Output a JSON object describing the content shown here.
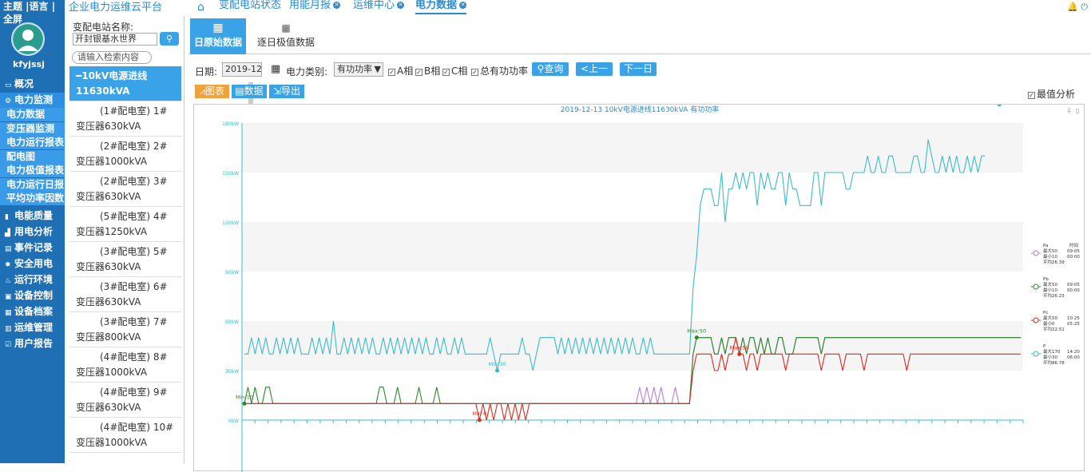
{
  "nav": {
    "top_menu": "主题 |语言 | 全屏",
    "username": "kfyjssj",
    "items": [
      {
        "label": "概况",
        "icon": "monitor-icon",
        "active": false
      },
      {
        "label": "电力监测",
        "icon": "gear-icon",
        "active": true
      },
      {
        "label": "电能质量",
        "icon": "bar-icon",
        "active": false
      },
      {
        "label": "用电分析",
        "icon": "chart-icon",
        "active": false
      },
      {
        "label": "事件记录",
        "icon": "list-icon",
        "active": false
      },
      {
        "label": "安全用电",
        "icon": "shield-icon",
        "active": false
      },
      {
        "label": "运行环境",
        "icon": "env-icon",
        "active": false
      },
      {
        "label": "设备控制",
        "icon": "control-icon",
        "active": false
      },
      {
        "label": "设备档案",
        "icon": "file-icon",
        "active": false
      },
      {
        "label": "运维管理",
        "icon": "tool-icon",
        "active": false
      },
      {
        "label": "用户报告",
        "icon": "report-icon",
        "active": false
      }
    ],
    "sub_items": [
      "电力数据",
      "变压器监测",
      "电力运行报表",
      "配电图",
      "电力极值报表",
      "电力运行日报",
      "平均功率因数"
    ]
  },
  "platform_title": "企业电力运维云平台",
  "tabs": [
    {
      "label": "变配电站状态",
      "closable": false,
      "active": false
    },
    {
      "label": "用能月报",
      "closable": true,
      "active": false
    },
    {
      "label": "运维中心",
      "closable": true,
      "active": false
    },
    {
      "label": "电力数据",
      "closable": true,
      "active": true
    }
  ],
  "station_panel": {
    "label": "变配电站名称:",
    "station_value": "开封银基水世界",
    "filter_placeholder": "请输入检索内容",
    "items": [
      "━10kV电源进线11630kVA",
      "(1#配电室) 1#变压器630kVA",
      "(2#配电室) 2#变压器1000kVA",
      "(2#配电室) 3#变压器630kVA",
      "(5#配电室) 4#变压器1250kVA",
      "(3#配电室) 5#变压器630kVA",
      "(3#配电室) 6#变压器630kVA",
      "(3#配电室) 7#变压器800kVA",
      "(4#配电室) 8#变压器1000kVA",
      "(4#配电室) 9#变压器630kVA",
      "(4#配电室) 10#变压器1000kVA"
    ]
  },
  "subtabs": [
    "日原始数据",
    "逐日极值数据"
  ],
  "toolbar": {
    "date_label": "日期:",
    "date_value": "2019-12-13",
    "type_label": "电力类别:",
    "type_value": "有功功率",
    "checks": [
      "A相",
      "B相",
      "C相",
      "总有功功率"
    ],
    "query": "查询",
    "prev": "上一日",
    "next": "下一日",
    "chart_btn": "图表",
    "data_btn": "数据",
    "export_btn": "导出",
    "best_label": "最值分析"
  },
  "chart_data": {
    "type": "line",
    "title": "2019-12-13  10kV电源进线11630kVA  有功功率",
    "y_ticks": [
      "0kW",
      "30kW",
      "60kW",
      "90kW",
      "120kW",
      "150kW",
      "180kW"
    ],
    "ylim": [
      0,
      180
    ],
    "colors": {
      "Pa": "#b57fe0",
      "Pb": "#2a8a2a",
      "Pc": "#e0281c",
      "P": "#3bbcc8"
    },
    "series": [
      {
        "name": "Pa",
        "stats": [
          "最大50",
          "09:05",
          "最小10",
          "00:00",
          "平均26.39"
        ],
        "values": [
          10,
          10,
          10,
          10,
          10,
          10,
          10,
          10,
          10,
          10,
          10,
          10,
          10,
          10,
          10,
          10,
          10,
          10,
          10,
          10,
          10,
          10,
          10,
          10,
          10,
          10,
          10,
          10,
          10,
          10,
          10,
          10,
          10,
          10,
          10,
          10,
          10,
          10,
          10,
          10,
          10,
          10,
          10,
          10,
          10,
          10,
          10,
          10,
          10,
          10,
          10,
          10,
          10,
          10,
          10,
          10,
          10,
          10,
          10,
          10,
          10,
          10,
          10,
          10,
          10,
          10,
          10,
          10,
          10,
          10,
          10,
          10,
          10,
          10,
          10,
          10,
          10,
          10,
          10,
          10,
          10,
          10,
          10,
          10,
          10,
          10,
          10,
          10,
          10,
          10,
          10,
          10,
          10,
          10,
          10,
          10,
          10,
          10,
          10,
          10,
          10,
          10,
          10,
          10,
          10,
          10,
          10,
          10,
          10,
          10,
          10,
          20,
          10,
          20,
          10,
          20,
          10,
          20,
          10,
          10,
          10,
          20,
          10,
          10,
          10,
          10,
          40,
          50,
          50,
          50,
          50,
          50,
          40,
          40,
          50,
          40,
          50,
          50,
          50,
          40,
          50,
          40,
          50,
          50,
          40,
          50,
          40,
          50,
          40,
          40,
          50,
          50,
          40,
          40,
          40,
          50,
          50,
          50,
          50,
          50,
          50,
          50,
          40,
          50,
          50,
          50,
          50,
          50,
          50,
          50,
          50,
          50,
          50,
          50,
          50,
          50,
          50,
          50,
          50,
          50,
          50,
          50,
          50,
          50,
          50,
          50,
          50,
          50,
          50,
          50,
          50,
          50,
          50,
          50,
          50,
          50,
          50,
          50,
          50,
          50,
          50,
          50,
          50,
          50,
          50,
          50,
          50,
          50,
          50,
          50,
          50,
          50,
          50,
          50,
          50,
          50,
          50,
          50,
          50
        ]
      },
      {
        "name": "Pb",
        "stats": [
          "最大50",
          "09:05",
          "最小10",
          "00:00",
          "平均26.23"
        ],
        "values": [
          10,
          20,
          10,
          20,
          10,
          10,
          20,
          20,
          10,
          10,
          10,
          10,
          10,
          10,
          10,
          10,
          10,
          10,
          10,
          10,
          10,
          10,
          10,
          10,
          10,
          10,
          10,
          10,
          10,
          10,
          10,
          10,
          10,
          10,
          10,
          10,
          10,
          10,
          20,
          20,
          10,
          10,
          10,
          20,
          10,
          10,
          10,
          10,
          10,
          20,
          10,
          10,
          10,
          10,
          20,
          10,
          10,
          10,
          10,
          10,
          10,
          10,
          10,
          10,
          10,
          10,
          10,
          10,
          10,
          10,
          10,
          10,
          10,
          10,
          10,
          10,
          10,
          10,
          10,
          10,
          10,
          10,
          10,
          10,
          10,
          10,
          10,
          10,
          10,
          10,
          10,
          10,
          10,
          10,
          10,
          10,
          10,
          10,
          10,
          10,
          10,
          10,
          10,
          10,
          10,
          10,
          10,
          10,
          10,
          10,
          10,
          10,
          10,
          10,
          10,
          10,
          10,
          10,
          10,
          10,
          10,
          10,
          10,
          10,
          10,
          10,
          40,
          50,
          50,
          50,
          50,
          50,
          40,
          40,
          50,
          40,
          50,
          50,
          50,
          40,
          50,
          40,
          50,
          50,
          40,
          50,
          40,
          50,
          40,
          40,
          50,
          50,
          40,
          40,
          40,
          50,
          50,
          50,
          50,
          50,
          50,
          50,
          40,
          50,
          50,
          50,
          50,
          50,
          50,
          50,
          50,
          50,
          50,
          50,
          50,
          50,
          50,
          50,
          50,
          50,
          50,
          50,
          50,
          50,
          50,
          50,
          50,
          50,
          50,
          50,
          50,
          50,
          50,
          50,
          50,
          50,
          50,
          50,
          50,
          50,
          50,
          50,
          50,
          50,
          50,
          50,
          50,
          50,
          50,
          50,
          50,
          50,
          50,
          50,
          50,
          50,
          50,
          50,
          50
        ]
      },
      {
        "name": "Pc",
        "stats": [
          "最大50",
          "10:25",
          "最小0",
          "05:25",
          "平均22.51"
        ],
        "values": [
          10,
          10,
          10,
          10,
          10,
          10,
          10,
          10,
          10,
          10,
          10,
          10,
          10,
          10,
          10,
          10,
          10,
          10,
          10,
          10,
          10,
          10,
          10,
          10,
          10,
          10,
          10,
          10,
          10,
          10,
          10,
          10,
          10,
          10,
          10,
          10,
          10,
          10,
          10,
          10,
          10,
          10,
          10,
          10,
          10,
          10,
          10,
          10,
          10,
          10,
          10,
          10,
          10,
          10,
          10,
          10,
          10,
          10,
          10,
          10,
          10,
          10,
          10,
          10,
          10,
          10,
          0,
          10,
          0,
          10,
          0,
          10,
          10,
          0,
          10,
          0,
          10,
          0,
          10,
          0,
          10,
          10,
          10,
          10,
          10,
          10,
          10,
          10,
          10,
          10,
          10,
          10,
          10,
          10,
          10,
          10,
          10,
          10,
          10,
          10,
          10,
          10,
          10,
          10,
          10,
          10,
          10,
          10,
          10,
          10,
          10,
          10,
          10,
          10,
          10,
          10,
          10,
          10,
          10,
          10,
          10,
          10,
          10,
          10,
          10,
          10,
          30,
          40,
          40,
          40,
          40,
          40,
          30,
          30,
          40,
          30,
          40,
          40,
          50,
          40,
          40,
          30,
          40,
          40,
          30,
          40,
          40,
          40,
          40,
          40,
          40,
          40,
          30,
          40,
          40,
          40,
          40,
          40,
          40,
          40,
          40,
          40,
          30,
          40,
          40,
          40,
          40,
          40,
          30,
          40,
          40,
          40,
          40,
          40,
          30,
          40,
          40,
          40,
          40,
          40,
          40,
          40,
          40,
          40,
          40,
          40,
          30,
          40,
          40,
          40,
          40,
          40,
          40,
          40,
          40,
          40,
          40,
          40,
          40,
          40,
          40,
          40,
          40,
          40,
          40,
          40,
          40,
          40,
          40,
          40,
          40,
          40,
          40,
          40,
          40,
          40,
          40,
          40,
          40
        ]
      },
      {
        "name": "P",
        "stats": [
          "最大170",
          "14:20",
          "最小30",
          "06:00",
          "平均86.78"
        ],
        "values": [
          40,
          40,
          50,
          40,
          50,
          40,
          50,
          40,
          40,
          50,
          40,
          50,
          40,
          50,
          40,
          50,
          40,
          40,
          40,
          50,
          40,
          50,
          40,
          50,
          40,
          60,
          40,
          40,
          50,
          40,
          50,
          40,
          50,
          40,
          50,
          40,
          50,
          40,
          40,
          50,
          40,
          50,
          40,
          50,
          40,
          50,
          40,
          50,
          40,
          50,
          40,
          50,
          40,
          40,
          50,
          40,
          50,
          40,
          40,
          50,
          40,
          50,
          40,
          40,
          40,
          40,
          40,
          40,
          40,
          50,
          40,
          30,
          40,
          40,
          40,
          40,
          40,
          40,
          50,
          40,
          40,
          30,
          40,
          50,
          50,
          50,
          50,
          50,
          40,
          50,
          40,
          50,
          40,
          50,
          40,
          50,
          40,
          50,
          40,
          50,
          40,
          50,
          40,
          50,
          40,
          50,
          40,
          50,
          40,
          50,
          40,
          40,
          50,
          40,
          50,
          40,
          40,
          40,
          40,
          40,
          40,
          40,
          40,
          40,
          40,
          40,
          80,
          100,
          130,
          140,
          140,
          140,
          130,
          130,
          150,
          120,
          140,
          140,
          150,
          140,
          150,
          140,
          150,
          150,
          130,
          150,
          140,
          150,
          140,
          140,
          150,
          150,
          130,
          150,
          140,
          140,
          130,
          130,
          130,
          130,
          150,
          150,
          130,
          150,
          150,
          150,
          150,
          150,
          150,
          140,
          140,
          150,
          150,
          150,
          150,
          160,
          150,
          150,
          160,
          150,
          150,
          160,
          160,
          150,
          150,
          150,
          150,
          150,
          160,
          160,
          150,
          150,
          170,
          160,
          150,
          150,
          160,
          150,
          160,
          150,
          160,
          150,
          150,
          160,
          150,
          160,
          150,
          160,
          160
        ]
      }
    ],
    "annotations": [
      {
        "text": "Min:10",
        "series": "Pb",
        "index": 0
      },
      {
        "text": "Min:0",
        "series": "Pc",
        "index": 66
      },
      {
        "text": "Min:30",
        "series": "P",
        "index": 71
      },
      {
        "text": "Max:50",
        "series": "Pb",
        "index": 127
      },
      {
        "text": "Max:50",
        "series": "Pc",
        "index": 139
      },
      {
        "text": "Max:170",
        "series": "P",
        "index": 212
      }
    ]
  }
}
